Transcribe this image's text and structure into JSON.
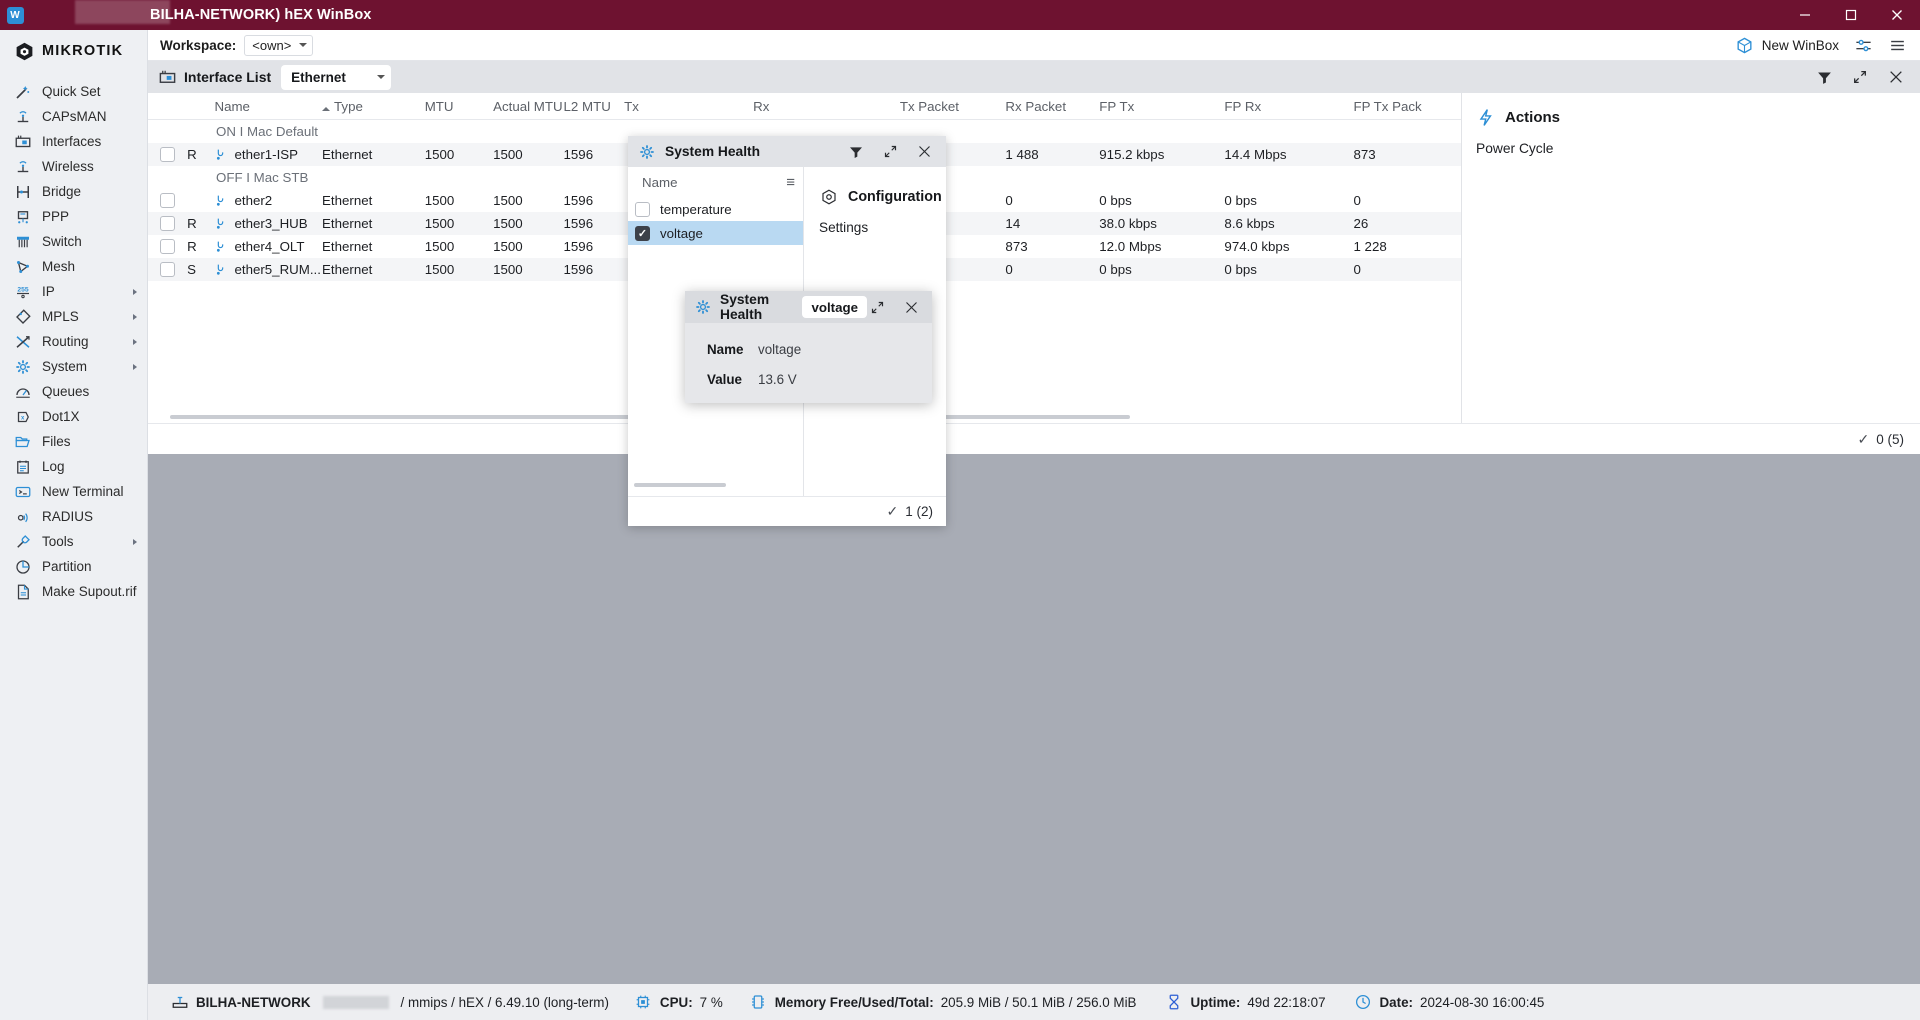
{
  "window": {
    "title": "BILHA-NETWORK) hEX WinBox",
    "app_icon": "winbox-icon",
    "minimize_label": "–",
    "maximize_label": "❐",
    "close_label": "✕",
    "titlebar_color": "#6e1230"
  },
  "sidebar": {
    "brand": "MIKROTIK",
    "items": [
      {
        "label": "Quick Set",
        "icon": "wand-icon",
        "submenu": false
      },
      {
        "label": "CAPsMAN",
        "icon": "antenna-icon",
        "submenu": false
      },
      {
        "label": "Interfaces",
        "icon": "nic-card-icon",
        "submenu": false
      },
      {
        "label": "Wireless",
        "icon": "antenna-icon",
        "submenu": false
      },
      {
        "label": "Bridge",
        "icon": "bridge-icon",
        "submenu": false
      },
      {
        "label": "PPP",
        "icon": "ppp-icon",
        "submenu": false
      },
      {
        "label": "Switch",
        "icon": "switch-icon",
        "submenu": false
      },
      {
        "label": "Mesh",
        "icon": "mesh-icon",
        "submenu": false
      },
      {
        "label": "IP",
        "icon": "ip-255-icon",
        "submenu": true
      },
      {
        "label": "MPLS",
        "icon": "tag-icon",
        "submenu": true
      },
      {
        "label": "Routing",
        "icon": "routing-icon",
        "submenu": true
      },
      {
        "label": "System",
        "icon": "gear-icon",
        "submenu": true
      },
      {
        "label": "Queues",
        "icon": "queues-icon",
        "submenu": false
      },
      {
        "label": "Dot1X",
        "icon": "dot1x-icon",
        "submenu": false
      },
      {
        "label": "Files",
        "icon": "folder-icon",
        "submenu": false
      },
      {
        "label": "Log",
        "icon": "log-icon",
        "submenu": false
      },
      {
        "label": "New Terminal",
        "icon": "terminal-icon",
        "submenu": false
      },
      {
        "label": "RADIUS",
        "icon": "radius-icon",
        "submenu": false
      },
      {
        "label": "Tools",
        "icon": "tools-icon",
        "submenu": true
      },
      {
        "label": "Partition",
        "icon": "partition-icon",
        "submenu": false
      },
      {
        "label": "Make Supout.rif",
        "icon": "supout-icon",
        "submenu": false
      }
    ]
  },
  "toolbar": {
    "workspace_label": "Workspace:",
    "workspace_value": "<own>",
    "new_winbox_label": "New WinBox",
    "new_winbox_icon": "cube-icon",
    "settings_icon": "sliders-icon",
    "menu_icon": "hamburger-icon"
  },
  "panel": {
    "icon": "nic-card-icon",
    "title": "Interface List",
    "chip": "Ethernet",
    "filter_icon": "funnel-icon",
    "expand_icon": "expand-icon",
    "close_icon": "close-icon"
  },
  "table": {
    "columns": [
      "Name",
      "Type",
      "MTU",
      "Actual MTU",
      "L2 MTU",
      "Tx",
      "Rx",
      "Tx Packet",
      "Rx Packet",
      "FP Tx",
      "FP Rx",
      "FP Tx Pack"
    ],
    "sorted_column": "Name",
    "rows": [
      {
        "kind": "group",
        "label": "ON I Mac Default"
      },
      {
        "kind": "data",
        "flag": "R",
        "name": "ether1-ISP",
        "type": "Ethernet",
        "mtu": "1500",
        "actual_mtu": "1500",
        "l2_mtu": "1596",
        "tx": "",
        "rx": "",
        "tx_packet": "",
        "rx_packet": "1 488",
        "fp_tx": "915.2 kbps",
        "fp_rx": "14.4 Mbps",
        "fp_tx_pack": "873"
      },
      {
        "kind": "group",
        "label": "OFF I Mac STB"
      },
      {
        "kind": "data",
        "flag": "",
        "name": "ether2",
        "type": "Ethernet",
        "mtu": "1500",
        "actual_mtu": "1500",
        "l2_mtu": "1596",
        "tx": "",
        "rx": "",
        "tx_packet": "",
        "rx_packet": "0",
        "fp_tx": "0 bps",
        "fp_rx": "0 bps",
        "fp_tx_pack": "0"
      },
      {
        "kind": "data",
        "flag": "R",
        "name": "ether3_HUB",
        "type": "Ethernet",
        "mtu": "1500",
        "actual_mtu": "1500",
        "l2_mtu": "1596",
        "tx": "",
        "rx": "",
        "tx_packet": "",
        "rx_packet": "14",
        "fp_tx": "38.0 kbps",
        "fp_rx": "8.6 kbps",
        "fp_tx_pack": "26"
      },
      {
        "kind": "data",
        "flag": "R",
        "name": "ether4_OLT",
        "type": "Ethernet",
        "mtu": "1500",
        "actual_mtu": "1500",
        "l2_mtu": "1596",
        "tx": "",
        "rx": "",
        "tx_packet": "",
        "rx_packet": "873",
        "fp_tx": "12.0 Mbps",
        "fp_rx": "974.0 kbps",
        "fp_tx_pack": "1 228"
      },
      {
        "kind": "data",
        "flag": "S",
        "name": "ether5_RUM...",
        "type": "Ethernet",
        "mtu": "1500",
        "actual_mtu": "1500",
        "l2_mtu": "1596",
        "tx": "",
        "rx": "",
        "tx_packet": "",
        "rx_packet": "0",
        "fp_tx": "0 bps",
        "fp_rx": "0 bps",
        "fp_tx_pack": "0"
      }
    ],
    "footer_count": "0 (5)"
  },
  "actions_panel": {
    "icon": "actions-icon",
    "title": "Actions",
    "items": [
      "Power Cycle"
    ]
  },
  "system_health": {
    "icon": "gear-icon",
    "title": "System Health",
    "filter_icon": "funnel-icon",
    "expand_icon": "expand-icon",
    "close_icon": "close-icon",
    "column_header": "Name",
    "menu_icon": "hamburger-icon",
    "rows": [
      {
        "name": "temperature",
        "checked": false,
        "selected": false
      },
      {
        "name": "voltage",
        "checked": true,
        "selected": true
      }
    ],
    "configuration": {
      "icon": "hexagon-icon",
      "title": "Configuration",
      "items": [
        "Settings"
      ]
    },
    "footer_count": "1 (2)"
  },
  "detail_window": {
    "icon": "gear-icon",
    "title": "System Health",
    "chip": "voltage",
    "expand_icon": "expand-icon",
    "close_icon": "close-icon",
    "fields": [
      {
        "label": "Name",
        "value": "voltage"
      },
      {
        "label": "Value",
        "value": "13.6 V"
      }
    ]
  },
  "statusbar": {
    "router_icon": "router-icon",
    "identity": "BILHA-NETWORK",
    "platform": "/ mmips / hEX / 6.49.10 (long-term)",
    "cpu_icon": "cpu-icon",
    "cpu_label": "CPU:",
    "cpu_value": "7 %",
    "memory_icon": "memory-icon",
    "memory_label": "Memory Free/Used/Total:",
    "memory_value": "205.9 MiB / 50.1 MiB / 256.0 MiB",
    "uptime_icon": "hourglass-icon",
    "uptime_label": "Uptime:",
    "uptime_value": "49d 22:18:07",
    "date_icon": "clock-icon",
    "date_label": "Date:",
    "date_value": "2024-08-30 16:00:45"
  }
}
